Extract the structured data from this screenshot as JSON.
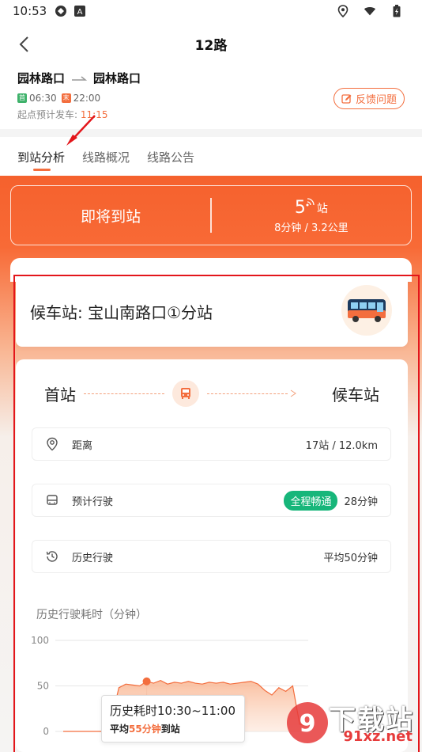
{
  "status": {
    "time": "10:53"
  },
  "header": {
    "title": "12路"
  },
  "route": {
    "from": "园林路口",
    "to": "园林路口",
    "first_tag": "首",
    "first_time": "06:30",
    "last_tag": "末",
    "last_time": "22:00",
    "depart_label": "起点预计发车:",
    "depart_time": "11:15"
  },
  "feedback": {
    "label": "反馈问题"
  },
  "tabs": [
    {
      "label": "到站分析"
    },
    {
      "label": "线路概况"
    },
    {
      "label": "线路公告"
    }
  ],
  "arrival": {
    "status": "即将到站",
    "stops": "5",
    "stops_unit": "站",
    "detail": "8分钟 / 3.2公里"
  },
  "station": {
    "label": "候车站: 宝山南路口①分站"
  },
  "journey": {
    "start": "首站",
    "end": "候车站",
    "rows": {
      "distance_label": "距离",
      "distance_value": "17站 / 12.0km",
      "eta_label": "预计行驶",
      "eta_badge": "全程畅通",
      "eta_value": "28分钟",
      "history_label": "历史行驶",
      "history_value": "平均50分钟"
    }
  },
  "chart_data": {
    "type": "area",
    "title": "历史行驶耗时（分钟）",
    "ylim": [
      0,
      100
    ],
    "yticks": [
      "100",
      "50",
      "0"
    ],
    "x": [
      0,
      1,
      2,
      3,
      4,
      5,
      6,
      7,
      8,
      9,
      10,
      11,
      12,
      13,
      14,
      15,
      16,
      17,
      18,
      19,
      20,
      21,
      22,
      23,
      24,
      25,
      26,
      27,
      28,
      29,
      30,
      31,
      32,
      33,
      34,
      35
    ],
    "values": [
      0,
      0,
      0,
      0,
      0,
      0,
      0,
      15,
      48,
      52,
      51,
      50,
      55,
      53,
      56,
      52,
      54,
      53,
      55,
      53,
      52,
      54,
      53,
      54,
      52,
      53,
      54,
      55,
      52,
      45,
      40,
      48,
      44,
      50,
      8,
      6
    ],
    "highlight_index": 12,
    "tooltip_title": "历史耗时10:30~11:00",
    "tooltip_prefix": "平均",
    "tooltip_value": "55分钟",
    "tooltip_suffix": "到站",
    "color": "#f36e3e"
  },
  "watermark": {
    "main": "下载站",
    "sub": "91xz.net"
  }
}
